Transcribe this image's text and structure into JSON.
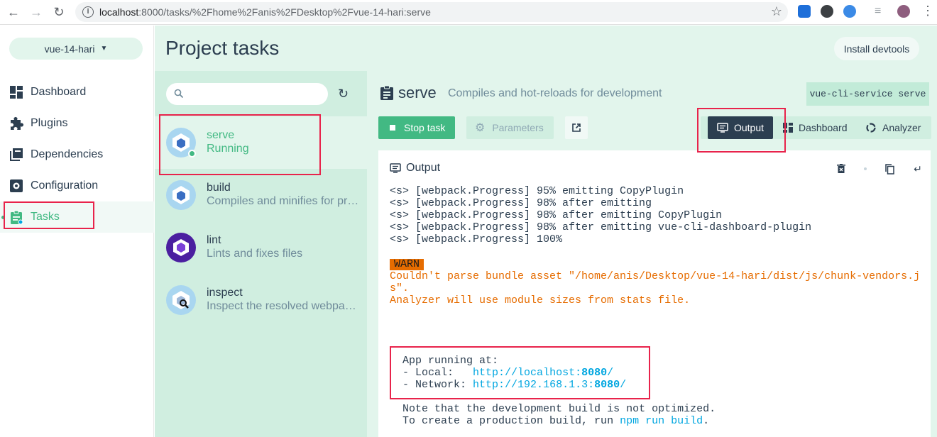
{
  "browser": {
    "url_host": "localhost",
    "url_rest": ":8000/tasks/%2Fhome%2Fanis%2FDesktop%2Fvue-14-hari:serve"
  },
  "sidebar": {
    "project": "vue-14-hari",
    "items": [
      {
        "label": "Dashboard",
        "icon": "dashboard-icon"
      },
      {
        "label": "Plugins",
        "icon": "puzzle-icon"
      },
      {
        "label": "Dependencies",
        "icon": "library-icon"
      },
      {
        "label": "Configuration",
        "icon": "settings-icon"
      },
      {
        "label": "Tasks",
        "icon": "assignment-icon"
      }
    ],
    "active": "Tasks"
  },
  "header": {
    "title": "Project tasks",
    "install_label": "Install devtools"
  },
  "tasks": [
    {
      "name": "serve",
      "desc": "Running"
    },
    {
      "name": "build",
      "desc": "Compiles and minifies for production"
    },
    {
      "name": "lint",
      "desc": "Lints and fixes files"
    },
    {
      "name": "inspect",
      "desc": "Inspect the resolved webpack config"
    }
  ],
  "detail": {
    "name": "serve",
    "desc": "Compiles and hot-reloads for development",
    "command": "vue-cli-service serve",
    "stop_label": "Stop task",
    "params_label": "Parameters",
    "tabs": {
      "output": "Output",
      "dashboard": "Dashboard",
      "analyzer": "Analyzer"
    },
    "output_title": "Output"
  },
  "terminal": {
    "progress": [
      "<s> [webpack.Progress] 95% emitting CopyPlugin",
      "<s> [webpack.Progress] 98% after emitting",
      "<s> [webpack.Progress] 98% after emitting CopyPlugin",
      "<s> [webpack.Progress] 98% after emitting vue-cli-dashboard-plugin",
      "<s> [webpack.Progress] 100%"
    ],
    "warn_badge": "WARN",
    "warn_lines": [
      "Couldn't parse bundle asset \"/home/anis/Desktop/vue-14-hari/dist/js/chunk-vendors.j",
      "s\".",
      "Analyzer will use module sizes from stats file."
    ],
    "app_running": "App running at:",
    "local_label": "- Local:   ",
    "local_url_a": "http://localhost:",
    "local_url_port": "8080",
    "local_url_b": "/",
    "network_label": "- Network: ",
    "network_url_a": "http://192.168.1.3:",
    "network_url_port": "8080",
    "network_url_b": "/",
    "note1": "Note that the development build is not optimized.",
    "note2_a": "To create a production build, run ",
    "note2_cmd": "npm run build",
    "note2_b": "."
  }
}
